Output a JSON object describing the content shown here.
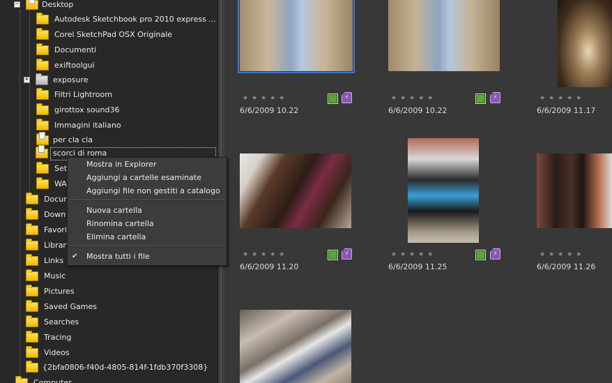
{
  "tree": {
    "items": [
      {
        "label": "Desktop"
      },
      {
        "label": "Autodesk Sketchbook pro 2010 express ..."
      },
      {
        "label": "Corel SketchPad  OSX Originale"
      },
      {
        "label": "Documenti"
      },
      {
        "label": "exiftoolgui"
      },
      {
        "label": "exposure"
      },
      {
        "label": "Filtri Lightroom"
      },
      {
        "label": "girottox sound36"
      },
      {
        "label": "Immagini italiano"
      },
      {
        "label": "per cla cla"
      },
      {
        "label": "scorci di roma"
      },
      {
        "label": "Set"
      },
      {
        "label": "WA"
      },
      {
        "label": "Docur"
      },
      {
        "label": "Down"
      },
      {
        "label": "Favori"
      },
      {
        "label": "Library"
      },
      {
        "label": "Links"
      },
      {
        "label": "Music"
      },
      {
        "label": "Pictures"
      },
      {
        "label": "Saved Games"
      },
      {
        "label": "Searches"
      },
      {
        "label": "Tracing"
      },
      {
        "label": "Videos"
      },
      {
        "label": "{2bfa0806-f40d-4805-814f-1fdb370f3308}"
      },
      {
        "label": "Computer"
      }
    ],
    "expand_minus": "−",
    "expand_plus": "+"
  },
  "menu": {
    "items": [
      {
        "label": "Mostra in Explorer"
      },
      {
        "label": "Aggiungi a cartelle esaminate"
      },
      {
        "label": "Aggiungi file non gestiti a catalogo"
      },
      {
        "label": "Nuova cartella"
      },
      {
        "label": "Rinomina cartella"
      },
      {
        "label": "Elimina cartella"
      },
      {
        "label": "Mostra tutti i file",
        "checked": true
      }
    ],
    "check_glyph": "✔"
  },
  "grid": {
    "stars": "★★★★★",
    "badge_glyph": "⚡",
    "thumbs": [
      {
        "date": "6/6/2009 10.22",
        "badges": true,
        "selected": true
      },
      {
        "date": "6/6/2009 10.22",
        "badges": true
      },
      {
        "date": "6/6/2009 11.17",
        "badges": false
      },
      {
        "date": "6/6/2009 11.20",
        "badges": true
      },
      {
        "date": "6/6/2009 11.25",
        "badges": true
      },
      {
        "date": "6/6/2009 11.26",
        "badges": false
      },
      {
        "date": "",
        "badges": false
      }
    ]
  },
  "colors": {
    "accent": "#3a78d6",
    "folder": "#f2b705",
    "badge_green": "#5aa637",
    "badge_purple": "#8a56b7"
  }
}
